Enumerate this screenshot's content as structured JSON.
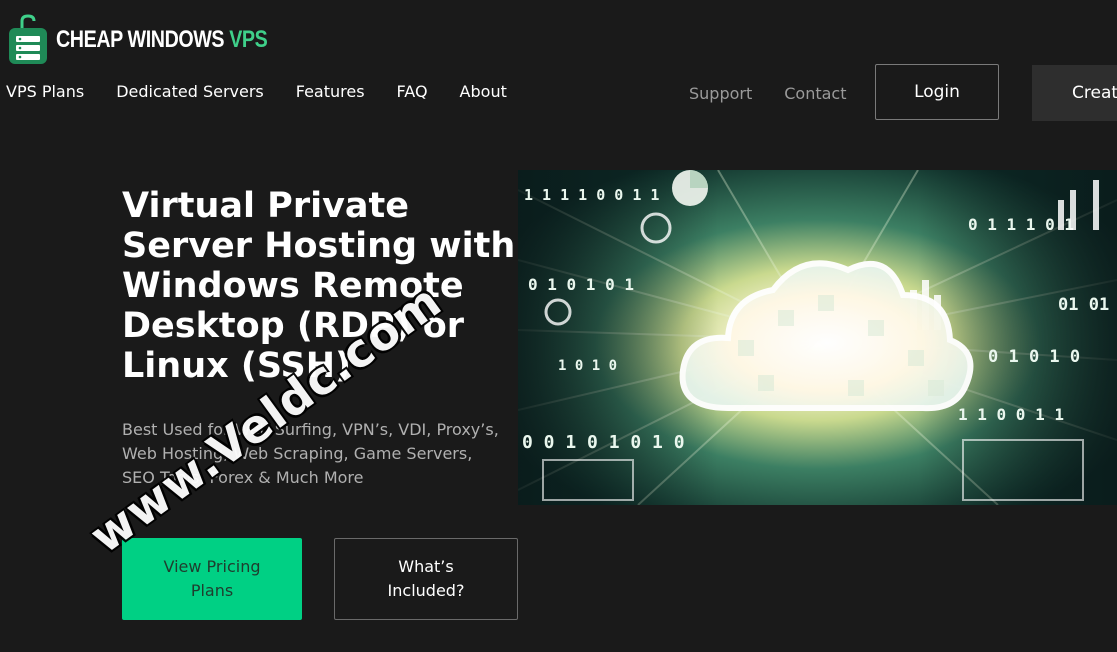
{
  "brand": {
    "name_part1": "CHEAP WINDOWS ",
    "name_part2": "VPS",
    "accent_color": "#3fd08a",
    "icon": "server-lock-logo-icon"
  },
  "nav": {
    "left": [
      "VPS Plans",
      "Dedicated Servers",
      "Features",
      "FAQ",
      "About"
    ],
    "right": [
      "Support",
      "Contact"
    ],
    "login_label": "Login",
    "create_label": "Create"
  },
  "hero": {
    "title": "Virtual Private Server Hosting with Windows Remote Desktop (RDP) or Linux (SSH)",
    "subtitle": "Best Used for Web Surfing, VPN’s, VDI, Proxy’s, Web Hosting, Web Scraping, Game Servers, SEO Tools, Forex & Much More",
    "primary_button": "View Pricing Plans",
    "secondary_button": "What’s Included?",
    "primary_color": "#00d084",
    "image": "cloud-binary-data-illustration"
  },
  "watermark": "www.Veldc.com",
  "image_text": {
    "r1": "1 1 1 1 0   0 1 1",
    "r2": "0 1 0 1 0 1",
    "r3": "0 0 1 0 1 0 1 0",
    "r4": "1 0 1 0",
    "r5": "01 01",
    "r6": "0 1 0 1 0",
    "r7": "1 1 0 0 1 1",
    "r8": "0 1 1 1 0 1"
  }
}
